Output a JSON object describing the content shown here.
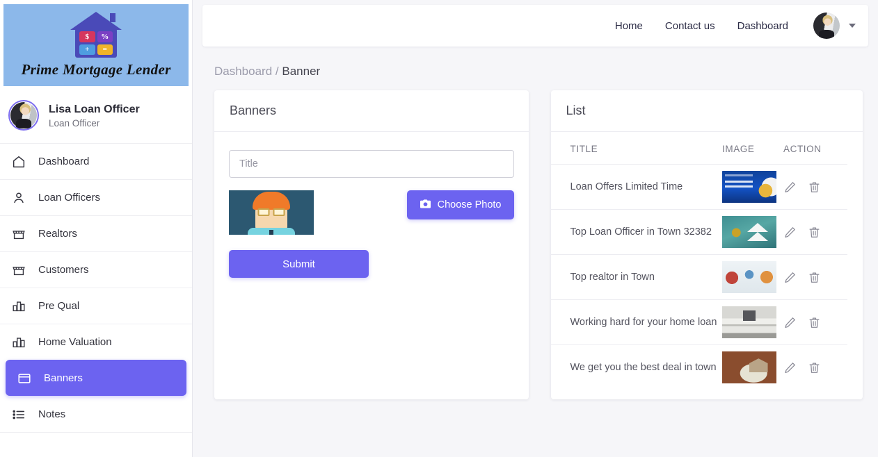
{
  "sidebar": {
    "logo": {
      "brand_text": "Prime Mortgage Lender",
      "keys": [
        "$",
        "%",
        "+",
        "="
      ]
    },
    "profile": {
      "name": "Lisa Loan Officer",
      "role": "Loan Officer",
      "avatar_icon": "user-avatar"
    },
    "items": [
      {
        "label": "Dashboard",
        "icon": "home-icon",
        "active": false
      },
      {
        "label": "Loan Officers",
        "icon": "person-icon",
        "active": false
      },
      {
        "label": "Realtors",
        "icon": "store-icon",
        "active": false
      },
      {
        "label": "Customers",
        "icon": "store-icon",
        "active": false
      },
      {
        "label": "Pre Qual",
        "icon": "bar-chart-icon",
        "active": false
      },
      {
        "label": "Home Valuation",
        "icon": "bar-chart-icon",
        "active": false
      },
      {
        "label": "Banners",
        "icon": "banner-icon",
        "active": true
      },
      {
        "label": "Notes",
        "icon": "list-icon",
        "active": false
      }
    ]
  },
  "topbar": {
    "links": [
      "Home",
      "Contact us",
      "Dashboard"
    ],
    "avatar_icon": "user-avatar",
    "caret_icon": "chevron-down-icon"
  },
  "breadcrumb": {
    "parent": "Dashboard",
    "separator": "/",
    "current": "Banner"
  },
  "banners_card": {
    "title": "Banners",
    "title_input": {
      "placeholder": "Title",
      "value": ""
    },
    "preview_icon": "photo-preview",
    "choose_photo_label": "Choose Photo",
    "choose_photo_icon": "camera-icon",
    "submit_label": "Submit"
  },
  "list_card": {
    "title": "List",
    "columns": [
      "TITLE",
      "IMAGE",
      "ACTION"
    ],
    "rows": [
      {
        "title": "Loan Offers Limited Time",
        "image": "th-finance",
        "edit_icon": "pencil-icon",
        "delete_icon": "trash-icon"
      },
      {
        "title": "Top Loan Officer in Town 32382",
        "image": "th-keys",
        "edit_icon": "pencil-icon",
        "delete_icon": "trash-icon"
      },
      {
        "title": "Top realtor in Town",
        "image": "th-people",
        "edit_icon": "pencil-icon",
        "delete_icon": "trash-icon"
      },
      {
        "title": "Working hard for your home loan",
        "image": "th-kitchen",
        "edit_icon": "pencil-icon",
        "delete_icon": "trash-icon"
      },
      {
        "title": "We get you the best deal in town",
        "image": "th-money",
        "edit_icon": "pencil-icon",
        "delete_icon": "trash-icon"
      }
    ]
  },
  "colors": {
    "primary": "#6C63F0",
    "logo_background": "#8CB8EA",
    "page_background": "#F6F6F9"
  }
}
